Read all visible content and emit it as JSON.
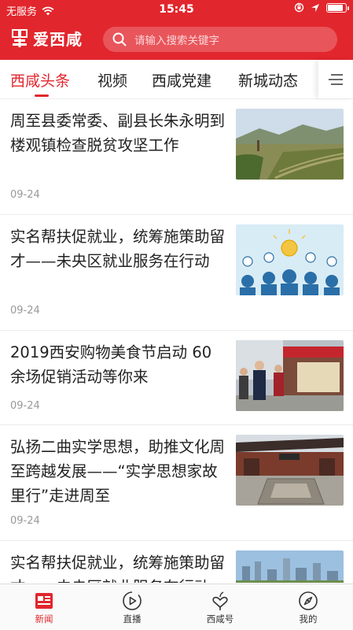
{
  "status_bar": {
    "carrier": "无服务",
    "time": "15:45",
    "battery_level": 0.9
  },
  "app": {
    "name": "爱西咸"
  },
  "search": {
    "placeholder": "请输入搜索关键字"
  },
  "tabs": [
    {
      "label": "西咸头条",
      "active": true
    },
    {
      "label": "视频",
      "active": false
    },
    {
      "label": "西咸党建",
      "active": false
    },
    {
      "label": "新城动态",
      "active": false
    }
  ],
  "news": [
    {
      "title": "周至县委常委、副县长朱永明到楼观镇检查脱贫攻坚工作",
      "date": "09-24"
    },
    {
      "title": "实名帮扶促就业，统筹施策助留才——未央区就业服务在行动",
      "date": "09-24"
    },
    {
      "title": "2019西安购物美食节启动 60余场促销活动等你来",
      "date": "09-24"
    },
    {
      "title": "弘扬二曲实学思想，助推文化周至跨越发展——“实学思想家故里行”走进周至",
      "date": "09-24"
    },
    {
      "title": "实名帮扶促就业，统筹施策助留才——未央区就业服务在行动",
      "date": ""
    }
  ],
  "bottom_nav": [
    {
      "label": "新闻",
      "icon": "news-icon",
      "active": true
    },
    {
      "label": "直播",
      "icon": "live-play-icon",
      "active": false
    },
    {
      "label": "西咸号",
      "icon": "heart-plant-icon",
      "active": false
    },
    {
      "label": "我的",
      "icon": "compass-icon",
      "active": false
    }
  ],
  "colors": {
    "brand": "#e2262d",
    "text": "#222222",
    "muted": "#999999"
  }
}
